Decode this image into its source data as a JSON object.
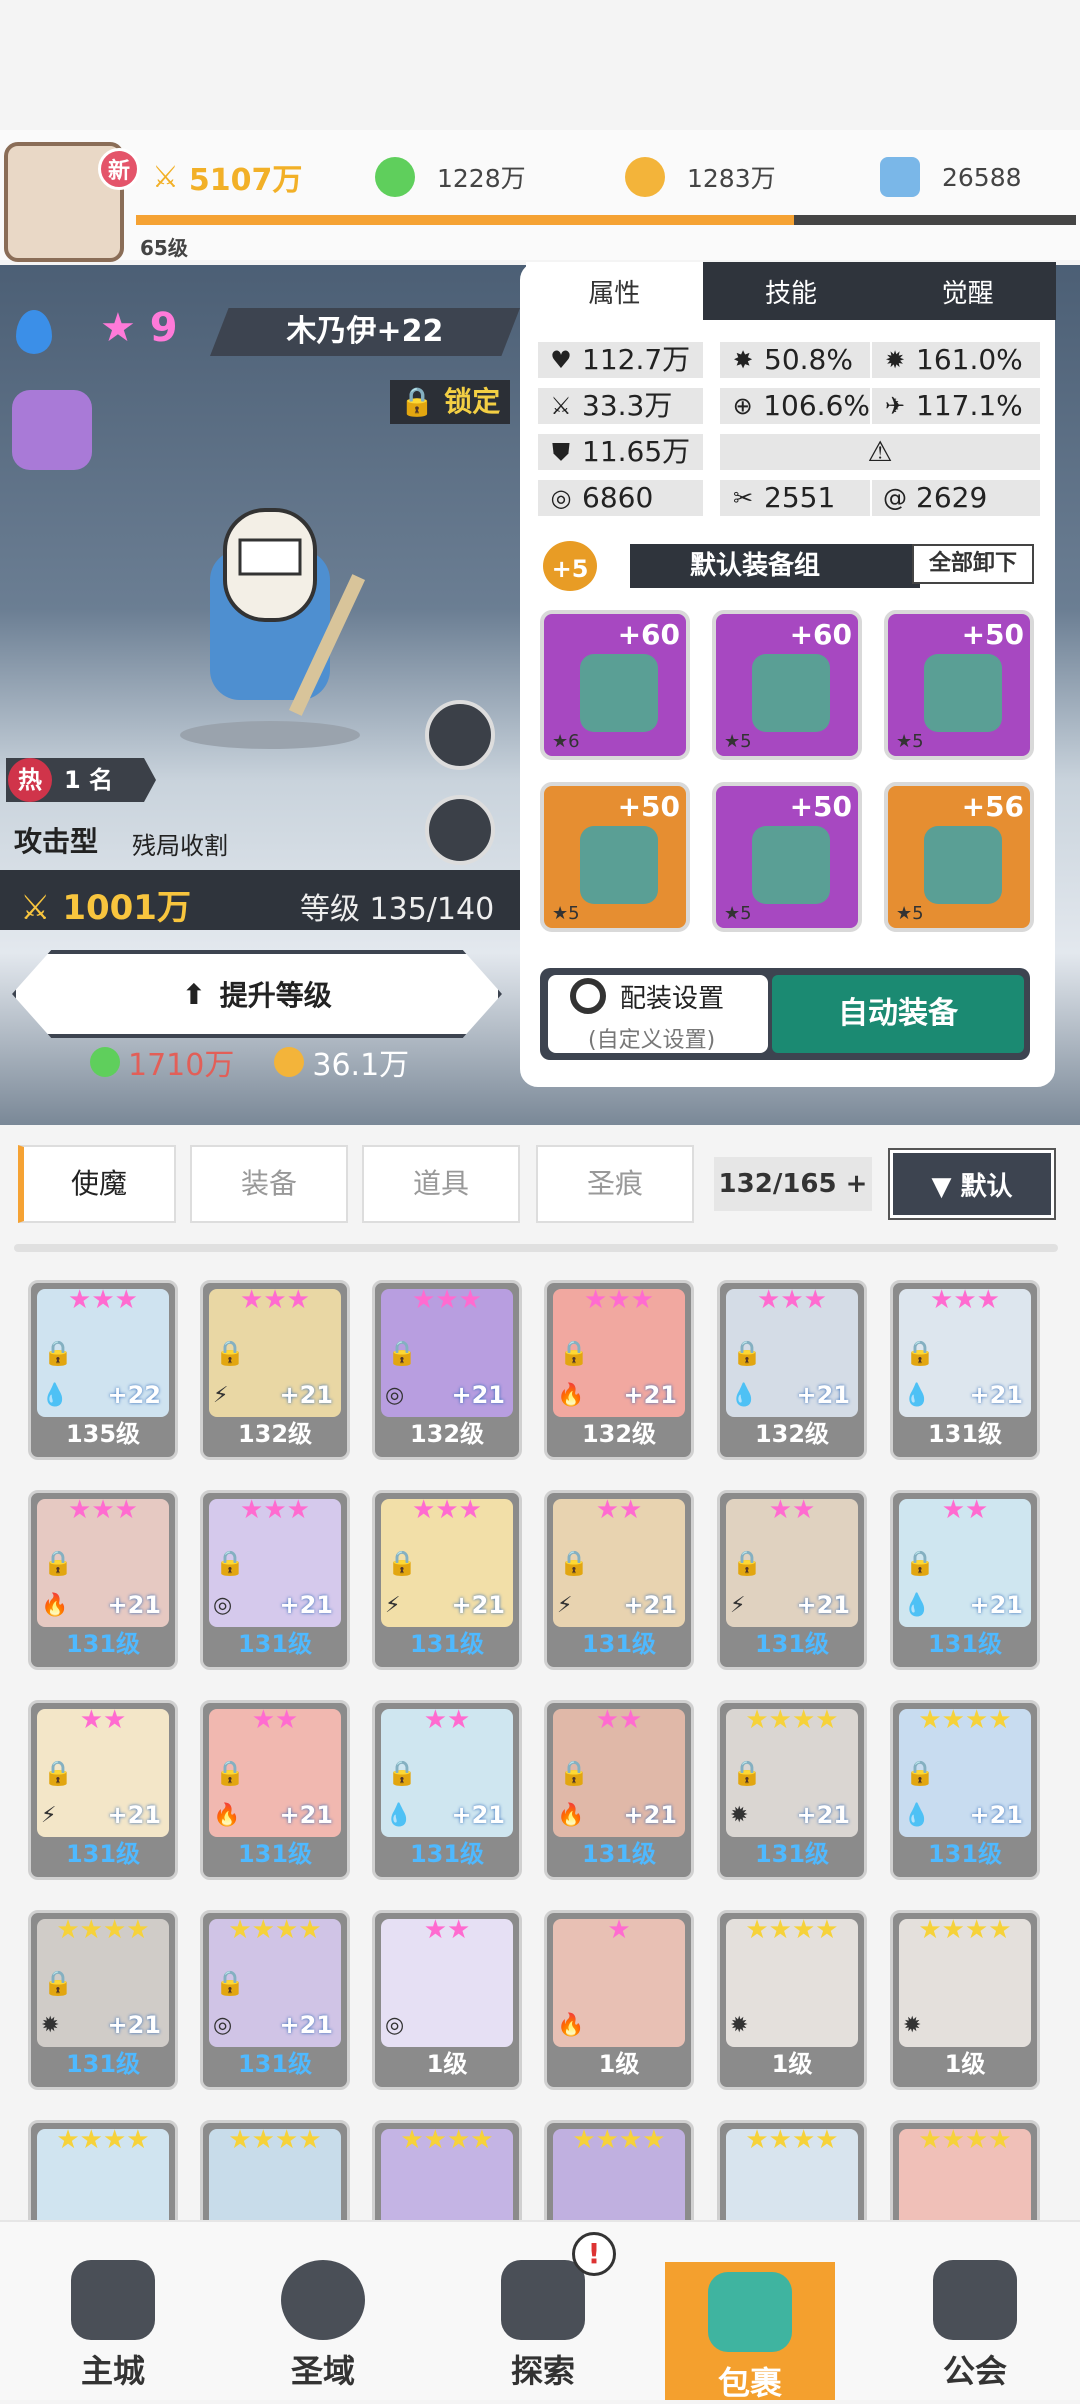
{
  "top": {
    "new_badge": "新",
    "power": "5107万",
    "green_coin": "1228万",
    "gold_coin": "1283万",
    "diamond": "26588",
    "level": "65级",
    "exp_fraction": 0.7
  },
  "hero": {
    "stars": "9",
    "name": "木乃伊+22",
    "lock": "锁定",
    "hot_icon": "热",
    "hot_rank": "1 名",
    "role": "攻击型",
    "tag": "残局收割",
    "power": "1001万",
    "level": "等级 135/140",
    "upgrade": "提升等级",
    "cost_green": "1710万",
    "cost_gold": "36.1万"
  },
  "tabs": {
    "attr": "属性",
    "skill": "技能",
    "awake": "觉醒"
  },
  "stats": {
    "hp": "112.7万",
    "crit": "50.8%",
    "crit_dmg": "161.0%",
    "atk": "33.3万",
    "acc": "106.6%",
    "spd": "117.1%",
    "def": "11.65万",
    "s1": "6860",
    "s2": "2551",
    "s3": "2629"
  },
  "gear": {
    "plus": "+5",
    "group": "默认装备组",
    "unequip": "全部卸下",
    "items": [
      {
        "plus": "+60",
        "lvl": "★6",
        "color": "purple"
      },
      {
        "plus": "+60",
        "lvl": "★5",
        "color": "purple"
      },
      {
        "plus": "+50",
        "lvl": "★5",
        "color": "purple"
      },
      {
        "plus": "+50",
        "lvl": "★5",
        "color": "orange"
      },
      {
        "plus": "+50",
        "lvl": "★5",
        "color": "purple"
      },
      {
        "plus": "+56",
        "lvl": "★5",
        "color": "orange"
      }
    ],
    "loadout": "配装设置",
    "loadout_sub": "(自定义设置)",
    "auto": "自动装备"
  },
  "inv": {
    "tabs": [
      "使魔",
      "装备",
      "道具",
      "圣痕"
    ],
    "count": "132/165 +",
    "sort": "▼ 默认"
  },
  "heroes": [
    {
      "stars": "★★★",
      "plus": "+22",
      "lvl": "135级",
      "elem": "💧"
    },
    {
      "stars": "★★★",
      "plus": "+21",
      "lvl": "132级",
      "elem": "⚡"
    },
    {
      "stars": "★★★",
      "plus": "+21",
      "lvl": "132级",
      "elem": "◎"
    },
    {
      "stars": "★★★",
      "plus": "+21",
      "lvl": "132级",
      "elem": "🔥"
    },
    {
      "stars": "★★★",
      "plus": "+21",
      "lvl": "132级",
      "elem": "💧"
    },
    {
      "stars": "★★★",
      "plus": "+21",
      "lvl": "131级",
      "elem": "💧"
    },
    {
      "stars": "★★★",
      "plus": "+21",
      "lvl": "131级",
      "elem": "🔥"
    },
    {
      "stars": "★★★",
      "plus": "+21",
      "lvl": "131级",
      "elem": "◎"
    },
    {
      "stars": "★★★",
      "plus": "+21",
      "lvl": "131级",
      "elem": "⚡"
    },
    {
      "stars": "★★",
      "plus": "+21",
      "lvl": "131级",
      "elem": "⚡"
    },
    {
      "stars": "★★",
      "plus": "+21",
      "lvl": "131级",
      "elem": "⚡"
    },
    {
      "stars": "★★",
      "plus": "+21",
      "lvl": "131级",
      "elem": "💧"
    },
    {
      "stars": "★★",
      "plus": "+21",
      "lvl": "131级",
      "elem": "⚡"
    },
    {
      "stars": "★★",
      "plus": "+21",
      "lvl": "131级",
      "elem": "🔥"
    },
    {
      "stars": "★★",
      "plus": "+21",
      "lvl": "131级",
      "elem": "💧"
    },
    {
      "stars": "★★",
      "plus": "+21",
      "lvl": "131级",
      "elem": "🔥"
    },
    {
      "stars": "★★★★",
      "plus": "+21",
      "lvl": "131级",
      "elem": "✹"
    },
    {
      "stars": "★★★★",
      "plus": "+21",
      "lvl": "131级",
      "elem": "💧"
    },
    {
      "stars": "★★★★",
      "plus": "+21",
      "lvl": "131级",
      "elem": "✹"
    },
    {
      "stars": "★★★★",
      "plus": "+21",
      "lvl": "131级",
      "elem": "◎"
    },
    {
      "stars": "★★",
      "plus": "",
      "lvl": "1级",
      "elem": "◎"
    },
    {
      "stars": "★",
      "plus": "",
      "lvl": "1级",
      "elem": "🔥"
    },
    {
      "stars": "★★★★",
      "plus": "",
      "lvl": "1级",
      "elem": "✹"
    },
    {
      "stars": "★★★★",
      "plus": "",
      "lvl": "1级",
      "elem": "✹"
    },
    {
      "stars": "★★★★",
      "plus": "",
      "lvl": "",
      "elem": ""
    },
    {
      "stars": "★★★★",
      "plus": "",
      "lvl": "",
      "elem": ""
    },
    {
      "stars": "★★★★",
      "plus": "",
      "lvl": "",
      "elem": ""
    },
    {
      "stars": "★★★★",
      "plus": "",
      "lvl": "",
      "elem": ""
    },
    {
      "stars": "★★★★",
      "plus": "",
      "lvl": "",
      "elem": ""
    },
    {
      "stars": "★★★★",
      "plus": "",
      "lvl": "",
      "elem": ""
    }
  ],
  "nav": {
    "city": "主城",
    "domain": "圣域",
    "explore": "探索",
    "bag": "包裹",
    "guild": "公会",
    "alert": "!"
  }
}
